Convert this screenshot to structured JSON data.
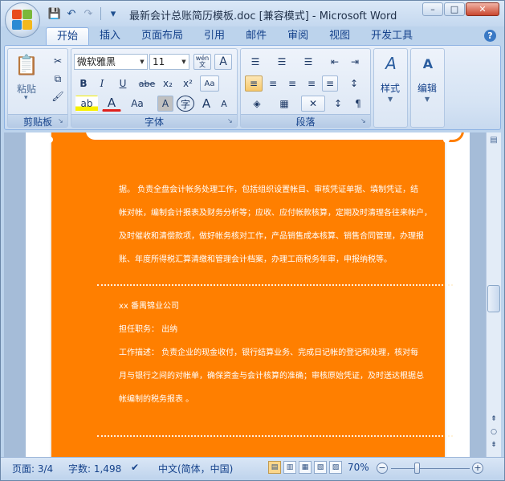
{
  "window": {
    "title": "最新会计总账简历模板.doc [兼容模式] - Microsoft Word",
    "controls": {
      "minimize": "–",
      "maximize": "□",
      "close": "✕"
    }
  },
  "quick_access": {
    "save_icon": "💾",
    "undo_icon": "↶",
    "redo_icon": "↷",
    "customize_icon": "▾"
  },
  "tabs": [
    {
      "label": "开始",
      "active": true
    },
    {
      "label": "插入"
    },
    {
      "label": "页面布局"
    },
    {
      "label": "引用"
    },
    {
      "label": "邮件"
    },
    {
      "label": "审阅"
    },
    {
      "label": "视图"
    },
    {
      "label": "开发工具"
    }
  ],
  "help": "?",
  "ribbon": {
    "clipboard": {
      "label": "剪贴板",
      "paste": "粘贴",
      "cut": "✂",
      "copy": "⧉",
      "format_painter": "🖌",
      "paste_arrow": "▾"
    },
    "font": {
      "label": "字体",
      "font_name": "微软雅黑",
      "font_size": "11",
      "wen": "wén\n文",
      "char_border": "A",
      "bold": "B",
      "italic": "I",
      "underline": "U",
      "strikethrough": "abe",
      "subscript": "x₂",
      "superscript": "x²",
      "clear_format": "Aa",
      "highlight": "ab",
      "font_color": "A",
      "change_case": "Aa",
      "char_shading": "A",
      "enclose": "字",
      "grow": "A",
      "shrink": "A"
    },
    "paragraph": {
      "label": "段落",
      "bullets": "☰",
      "numbering": "☰",
      "multilevel": "☰",
      "decrease_indent": "⇤",
      "increase_indent": "⇥",
      "align_left": "≡",
      "center": "≡",
      "align_right": "≡",
      "justify": "≡",
      "distributed": "≡",
      "line_spacing": "↕",
      "shading": "◈",
      "borders": "▦",
      "asian_layout": "✕",
      "sort": "↕",
      "show_marks": "¶"
    },
    "styles": {
      "label": "样式",
      "icon": "A"
    },
    "editing": {
      "label": "编辑",
      "icon": "A"
    }
  },
  "document": {
    "lines_top": [
      "据。  负责全盘会计帐务处理工作，包括组织设置帐目、审核凭证单据、填制凭证，结",
      "帐对帐，编制会计报表及财务分析等；应收、应付帐款核算，定期及时清理各往来帐户，",
      "及时催收和清偿款项，做好帐务核对工作，产品销售成本核算、销售合同管理，办理报",
      "账、年度所得税汇算清缴和管理会计档案，办理工商税务年审，申报纳税等。"
    ],
    "company": "xx 番禺锦业公司",
    "position": "担任职务：  出纳",
    "lines_bottom": [
      "工作描述：  负责企业的现金收付，银行结算业务、完成日记帐的登记和处理，核对每",
      "月与银行之间的对帐单，确保资金与会计核算的准确；审核原始凭证，及时送达根据总",
      "帐编制的税务报表  。"
    ]
  },
  "scrollbar": {
    "up": "▴",
    "prev": "⇞",
    "select": "○",
    "next": "⇟"
  },
  "status": {
    "page": "页面: 3/4",
    "words": "字数: 1,498",
    "proof_icon": "✔",
    "language": "中文(简体，中国)",
    "zoom": "70%",
    "zoom_out": "−",
    "zoom_in": "+",
    "view_icons": [
      "▤",
      "▥",
      "▦",
      "▧",
      "▨"
    ]
  }
}
